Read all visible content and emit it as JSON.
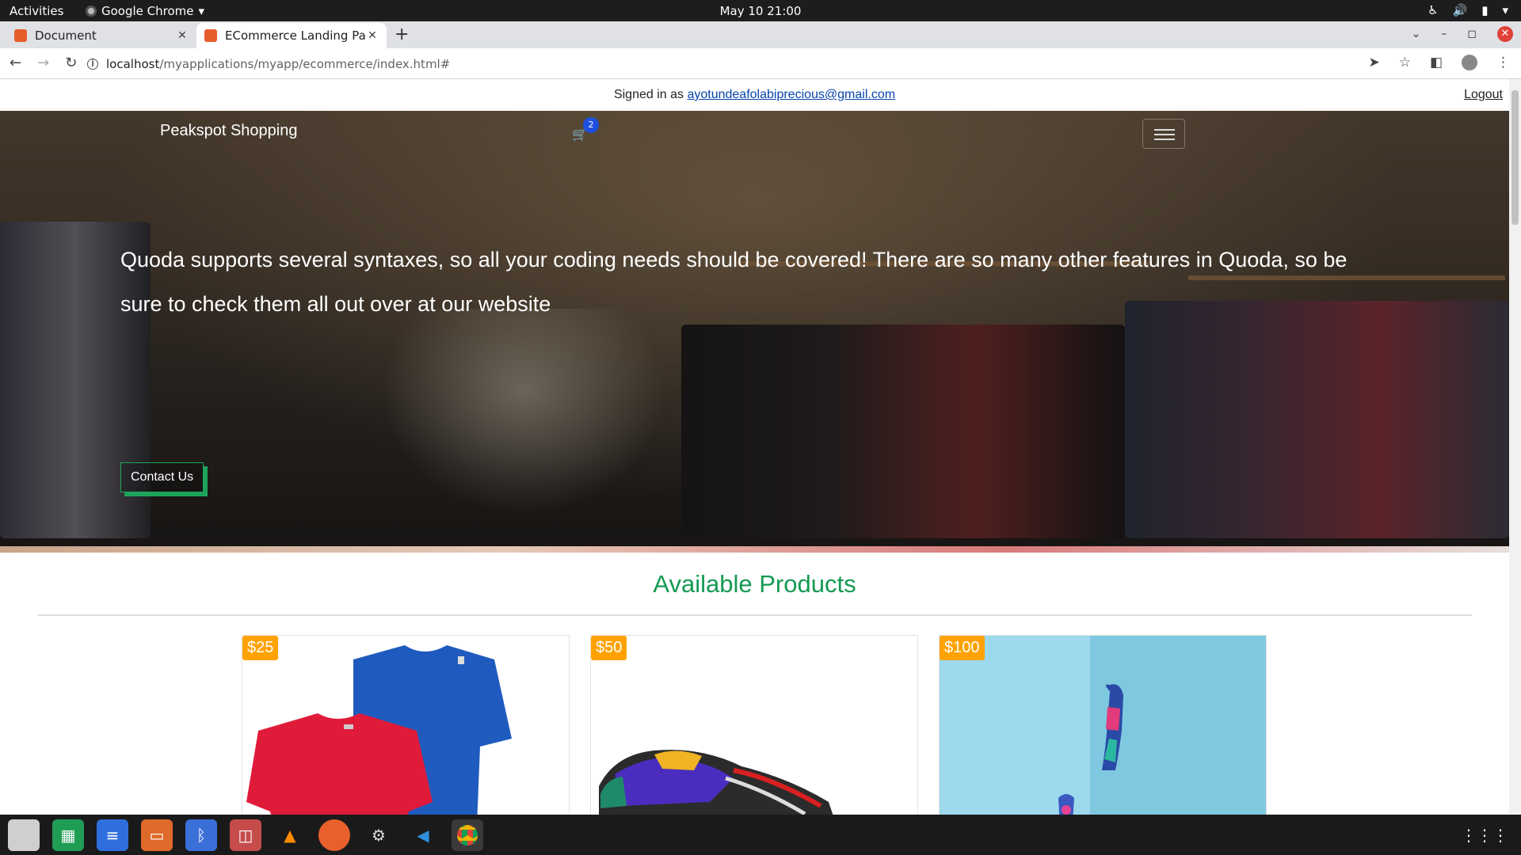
{
  "system": {
    "activities": "Activities",
    "app_name": "Google Chrome",
    "clock": "May 10  21:00"
  },
  "browser": {
    "tabs": [
      {
        "title": "Document",
        "active": false
      },
      {
        "title": "ECommerce Landing Page",
        "active": true
      }
    ],
    "url_host": "localhost",
    "url_path": "/myapplications/myapp/ecommerce/index.html#"
  },
  "page": {
    "signin_prefix": "Signed in as",
    "signin_email": "ayotundeafolabiprecious@gmail.com",
    "logout": "Logout",
    "brand": "Peakspot Shopping",
    "cart_count": "2",
    "hero_text": "Quoda supports several syntaxes, so all your coding needs should be covered! There are so many other features in Quoda, so be sure to check them all out over at our website",
    "contact_button": "Contact Us",
    "section_title": "Available Products",
    "products": [
      {
        "price": "$25",
        "image": "red and blue t-shirts"
      },
      {
        "price": "$50",
        "image": "colorful sneaker"
      },
      {
        "price": "$100",
        "image": "patterned sock on blue background"
      }
    ]
  },
  "colors": {
    "accent_green": "#159a53",
    "price_badge": "#ffa200",
    "cart_badge": "#1e4fe0"
  },
  "dock": {
    "apps": [
      "files-icon",
      "spreadsheet-icon",
      "document-icon",
      "presentation-icon",
      "bluetooth-icon",
      "screenshot-icon",
      "vlc-icon",
      "firefox-icon",
      "settings-icon",
      "vscode-icon",
      "chrome-icon"
    ]
  }
}
